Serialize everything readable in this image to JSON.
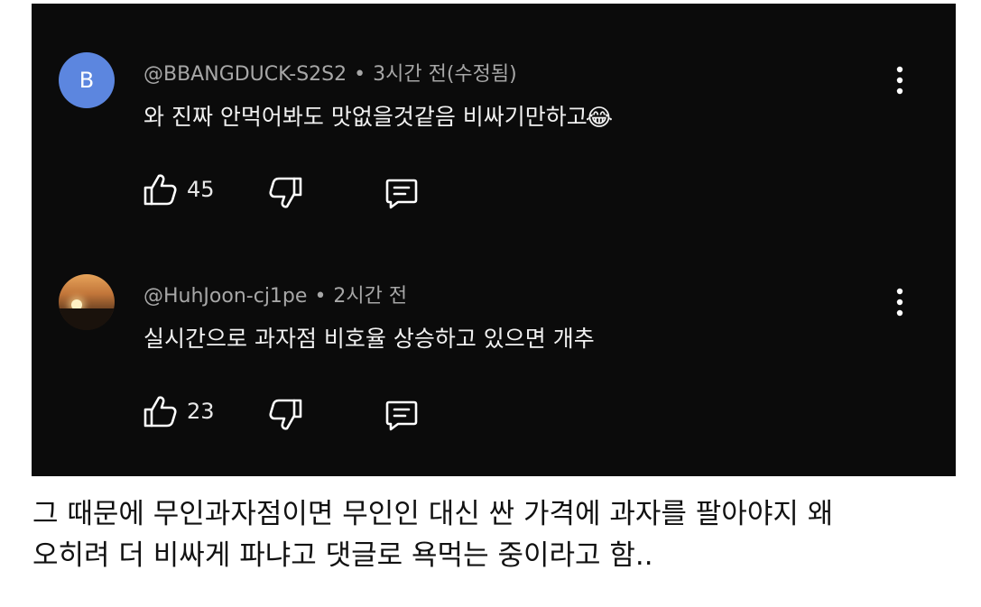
{
  "comments": [
    {
      "avatar_letter": "B",
      "avatar_color": "#5c86df",
      "username": "@BBANGDUCK-S2S2",
      "separator": "•",
      "time": "3시간 전(수정됨)",
      "text": "와 진짜 안먹어봐도 맛없을것같음  비싸기만하고",
      "emoji": "😂",
      "likes": "45"
    },
    {
      "avatar_icon": "sunset-avatar",
      "username": "@HuhJoon-cj1pe",
      "separator": "•",
      "time": "2시간 전",
      "text": "실시간으로 과자점 비호율 상승하고 있으면 개추",
      "likes": "23"
    }
  ],
  "caption": {
    "line1": "그 때문에 무인과자점이면 무인인 대신 싼 가격에 과자를 팔아야지 왜",
    "line2": "오히려 더 비싸게 파냐고 댓글로 욕먹는 중이라고 함.."
  },
  "colors": {
    "background": "#0b0b0b",
    "meta_text": "#a7a7a7",
    "body_text": "#f1f1f1"
  }
}
